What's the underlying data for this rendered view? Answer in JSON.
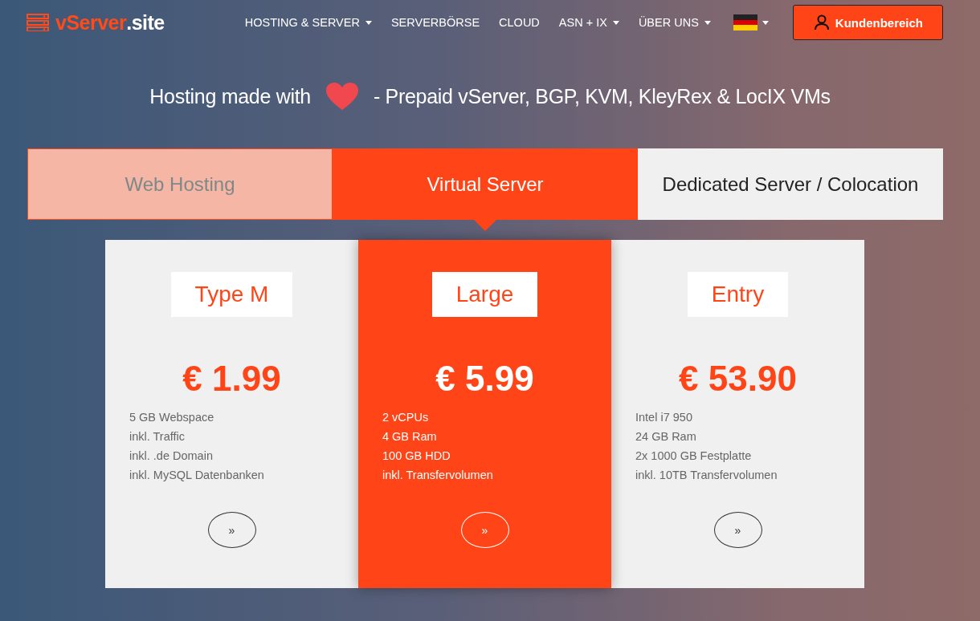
{
  "logo": {
    "name": "vServer",
    "suffix": ".site"
  },
  "nav": [
    {
      "label": "HOSTING & SERVER",
      "dropdown": true
    },
    {
      "label": "SERVERBÖRSE",
      "dropdown": false
    },
    {
      "label": "CLOUD",
      "dropdown": false
    },
    {
      "label": "ASN + IX",
      "dropdown": true
    },
    {
      "label": "ÜBER UNS",
      "dropdown": true
    }
  ],
  "account_button": "Kundenbereich",
  "headline": {
    "before": "Hosting made with",
    "after": "- Prepaid vServer, BGP, KVM, KleyRex & LocIX VMs"
  },
  "tabs": [
    {
      "label": "Web Hosting",
      "selected": false,
      "dimmed": true
    },
    {
      "label": "Virtual Server",
      "selected": true,
      "dimmed": false
    },
    {
      "label": "Dedicated Server / Colocation",
      "selected": false,
      "dimmed": false
    }
  ],
  "plans": [
    {
      "name": "Type M",
      "price": "€ 1.99",
      "highlighted": false,
      "features": [
        "5 GB Webspace",
        "inkl. Traffic",
        "inkl. .de Domain",
        "inkl. MySQL Datenbanken"
      ],
      "button": "»"
    },
    {
      "name": "Large",
      "price": "€ 5.99",
      "highlighted": true,
      "features": [
        "2 vCPUs",
        "4 GB Ram",
        "100 GB HDD",
        "inkl. Transfervolumen"
      ],
      "button": "»"
    },
    {
      "name": "Entry",
      "price": "€ 53.90",
      "highlighted": false,
      "features": [
        "Intel i7 950",
        "24 GB Ram",
        "2x 1000 GB Festplatte",
        "inkl. 10TB Transfervolumen"
      ],
      "button": "»"
    }
  ]
}
